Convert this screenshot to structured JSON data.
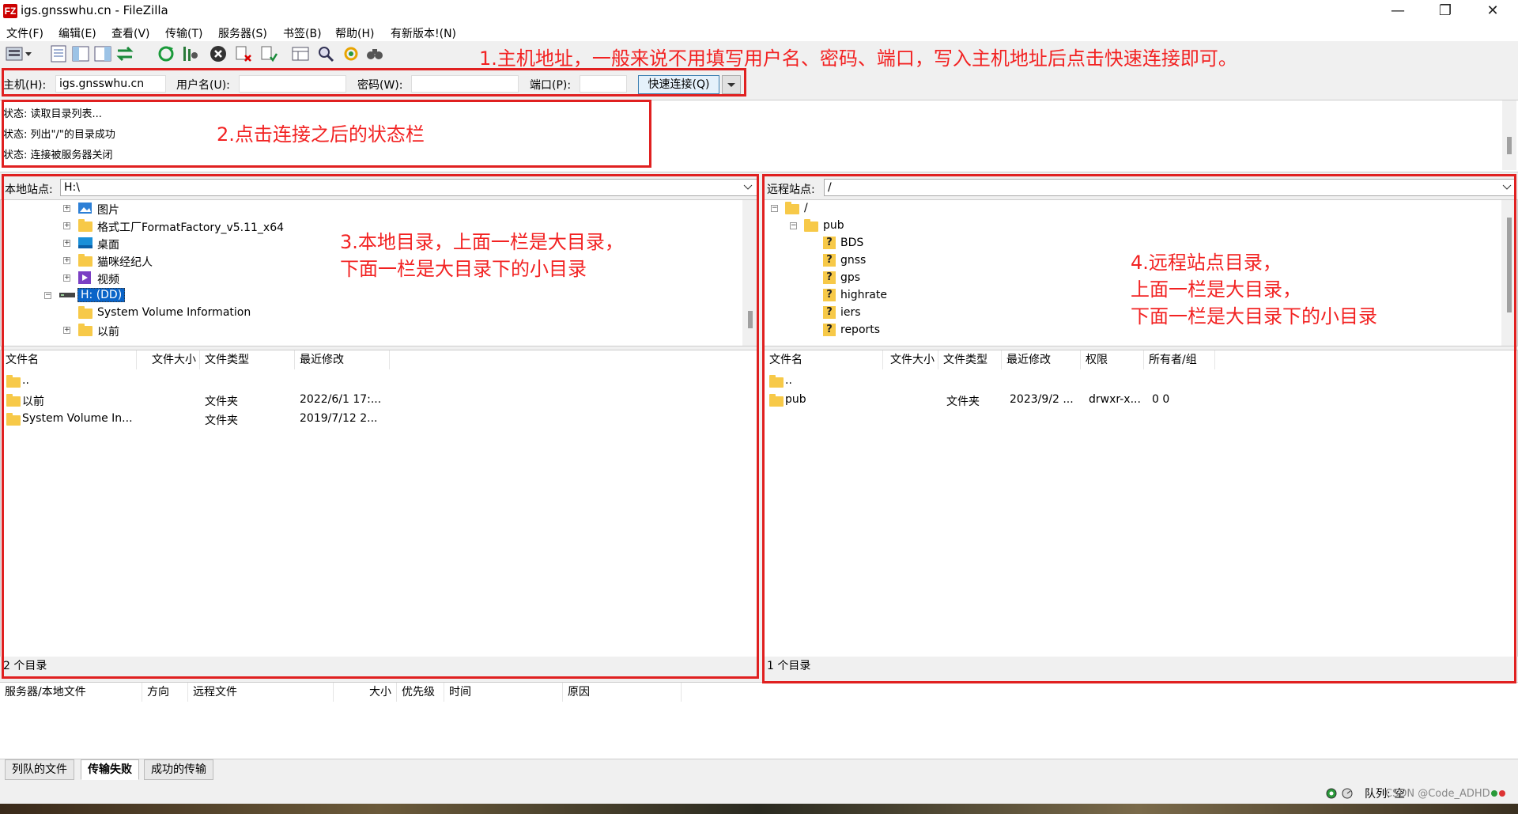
{
  "window": {
    "title": "igs.gnsswhu.cn - FileZilla",
    "app_icon_text": "FZ",
    "minimize": "—",
    "maximize": "❐",
    "close": "✕"
  },
  "menu": [
    "文件(F)",
    "编辑(E)",
    "查看(V)",
    "传输(T)",
    "服务器(S)",
    "书签(B)",
    "帮助(H)",
    "有新版本!(N)"
  ],
  "quickconnect": {
    "host_label": "主机(H):",
    "host_value": "igs.gnsswhu.cn",
    "user_label": "用户名(U):",
    "user_value": "",
    "pass_label": "密码(W):",
    "pass_value": "",
    "port_label": "端口(P):",
    "port_value": "",
    "button": "快速连接(Q)"
  },
  "log": [
    {
      "label": "状态:",
      "text": "读取目录列表..."
    },
    {
      "label": "状态:",
      "text": "列出\"/\"的目录成功"
    },
    {
      "label": "状态:",
      "text": "连接被服务器关闭"
    }
  ],
  "local": {
    "site_label": "本地站点:",
    "site_value": "H:\\",
    "tree": [
      {
        "label": "图片",
        "icon": "pictures-icon"
      },
      {
        "label": "格式工厂FormatFactory_v5.11_x64",
        "icon": "folder-icon"
      },
      {
        "label": "桌面",
        "icon": "desktop-icon"
      },
      {
        "label": "猫咪经纪人",
        "icon": "folder-icon"
      },
      {
        "label": "视频",
        "icon": "video-icon"
      },
      {
        "label": "H: (DD)",
        "icon": "drive-icon"
      },
      {
        "label": "System Volume Information",
        "icon": "folder-icon"
      },
      {
        "label": "以前",
        "icon": "folder-icon"
      }
    ],
    "columns": [
      "文件名",
      "文件大小",
      "文件类型",
      "最近修改"
    ],
    "rows": [
      {
        "name": "..",
        "size": "",
        "type": "",
        "modified": ""
      },
      {
        "name": "以前",
        "size": "",
        "type": "文件夹",
        "modified": "2022/6/1 17:..."
      },
      {
        "name": "System Volume In...",
        "size": "",
        "type": "文件夹",
        "modified": "2019/7/12 2..."
      }
    ],
    "status": "2 个目录"
  },
  "remote": {
    "site_label": "远程站点:",
    "site_value": "/",
    "tree": [
      {
        "label": "/"
      },
      {
        "label": "pub"
      },
      {
        "label": "BDS"
      },
      {
        "label": "gnss"
      },
      {
        "label": "gps"
      },
      {
        "label": "highrate"
      },
      {
        "label": "iers"
      },
      {
        "label": "reports"
      }
    ],
    "columns": [
      "文件名",
      "文件大小",
      "文件类型",
      "最近修改",
      "权限",
      "所有者/组"
    ],
    "rows": [
      {
        "name": "..",
        "size": "",
        "type": "",
        "modified": "",
        "perm": "",
        "owner": ""
      },
      {
        "name": "pub",
        "size": "",
        "type": "文件夹",
        "modified": "2023/9/2 ...",
        "perm": "drwxr-x...",
        "owner": "0 0"
      }
    ],
    "status": "1 个目录"
  },
  "queue": {
    "columns": [
      "服务器/本地文件",
      "方向",
      "远程文件",
      "大小",
      "优先级",
      "时间",
      "原因"
    ],
    "tabs": [
      "列队的文件",
      "传输失败",
      "成功的传输"
    ],
    "status_text": "队列: 空",
    "watermark": "CSDN @Code_ADHD"
  },
  "annotations": {
    "a1": "1.主机地址，一般来说不用填写用户名、密码、端口，写入主机地址后点击快速连接即可。",
    "a2": "2.点击连接之后的状态栏",
    "a3_line1": "3.本地目录，上面一栏是大目录，",
    "a3_line2": "下面一栏是大目录下的小目录",
    "a4_line1": "4.远程站点目录，",
    "a4_line2": "上面一栏是大目录，",
    "a4_line3": "下面一栏是大目录下的小目录"
  }
}
